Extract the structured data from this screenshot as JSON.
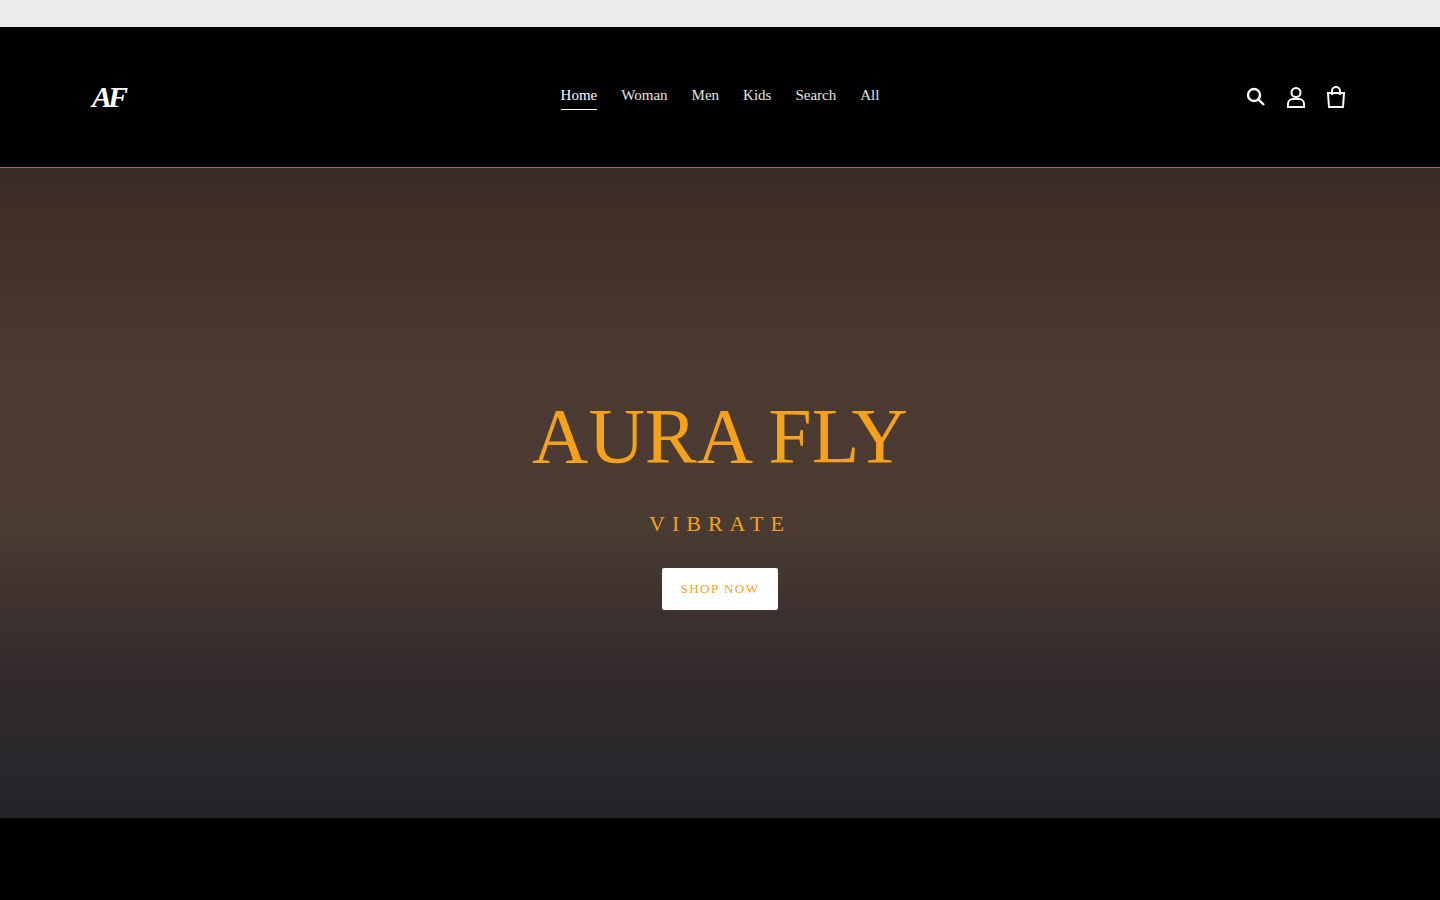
{
  "logo": "AF",
  "nav": [
    {
      "label": "Home",
      "selected": true
    },
    {
      "label": "Woman",
      "selected": false
    },
    {
      "label": "Men",
      "selected": false
    },
    {
      "label": "Kids",
      "selected": false
    },
    {
      "label": "Search",
      "selected": false
    },
    {
      "label": "All",
      "selected": false
    }
  ],
  "hero": {
    "title": "AURA FLY",
    "subtitle": "VIBRATE",
    "button": "SHOP NOW"
  }
}
